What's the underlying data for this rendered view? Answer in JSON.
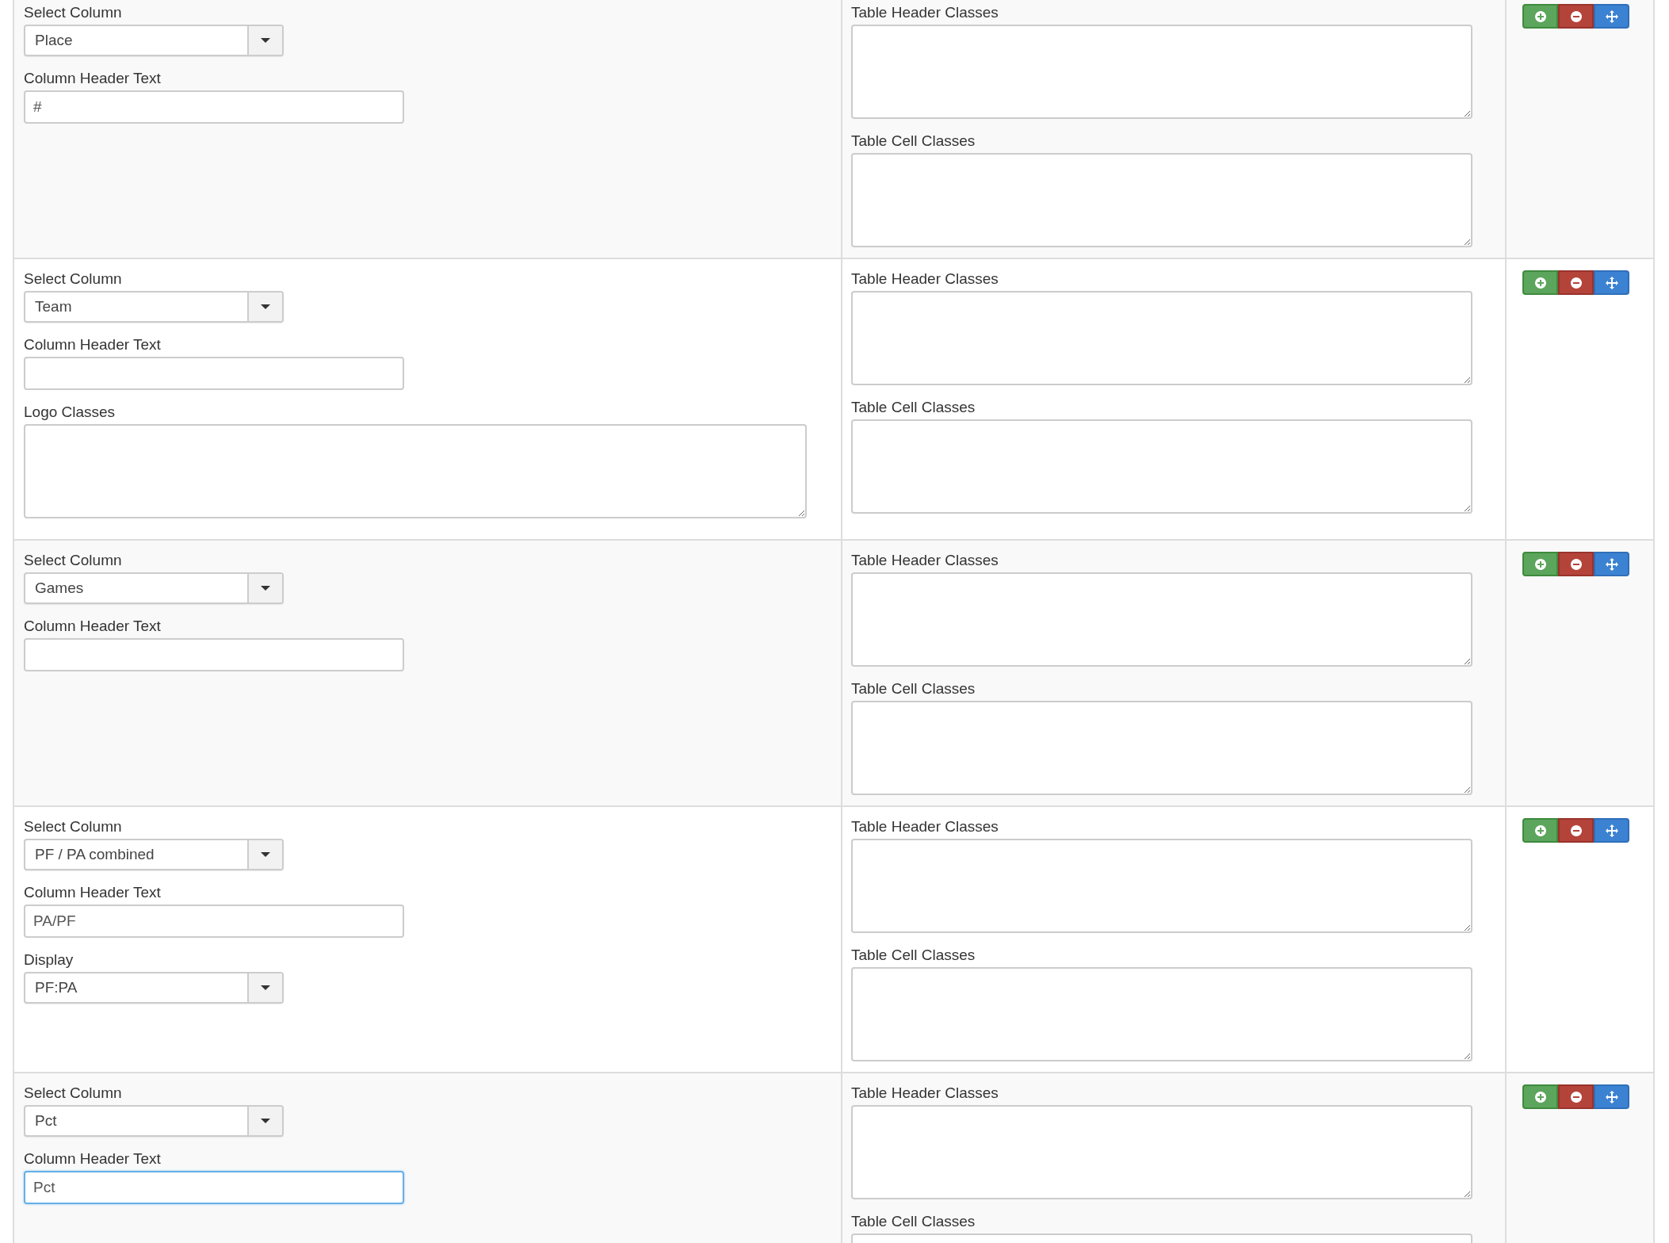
{
  "rows": [
    {
      "fields": [
        {
          "kind": "select",
          "label": "Select Column",
          "value": "Place"
        },
        {
          "kind": "text",
          "label": "Column Header Text",
          "value": "#",
          "focused": false
        }
      ],
      "side_fields": [
        {
          "label": "Table Header Classes"
        },
        {
          "label": "Table Cell Classes"
        }
      ]
    },
    {
      "fields": [
        {
          "kind": "select",
          "label": "Select Column",
          "value": "Team"
        },
        {
          "kind": "text",
          "label": "Column Header Text",
          "focused": false
        },
        {
          "kind": "textarea",
          "label": "Logo Classes"
        }
      ],
      "side_fields": [
        {
          "label": "Table Header Classes"
        },
        {
          "label": "Table Cell Classes"
        }
      ]
    },
    {
      "fields": [
        {
          "kind": "select",
          "label": "Select Column",
          "value": "Games"
        },
        {
          "kind": "text",
          "label": "Column Header Text",
          "focused": false
        }
      ],
      "side_fields": [
        {
          "label": "Table Header Classes"
        },
        {
          "label": "Table Cell Classes"
        }
      ]
    },
    {
      "fields": [
        {
          "kind": "select",
          "label": "Select Column",
          "value": "PF / PA combined"
        },
        {
          "kind": "text",
          "label": "Column Header Text",
          "value": "PA/PF",
          "focused": false
        },
        {
          "kind": "select",
          "label": "Display",
          "value": "PF:PA"
        }
      ],
      "side_fields": [
        {
          "label": "Table Header Classes"
        },
        {
          "label": "Table Cell Classes"
        }
      ]
    },
    {
      "fields": [
        {
          "kind": "select",
          "label": "Select Column",
          "value": "Pct"
        },
        {
          "kind": "text",
          "label": "Column Header Text",
          "value": "Pct",
          "focused": true
        }
      ],
      "side_fields": [
        {
          "label": "Table Header Classes"
        },
        {
          "label": "Table Cell Classes"
        }
      ]
    }
  ]
}
